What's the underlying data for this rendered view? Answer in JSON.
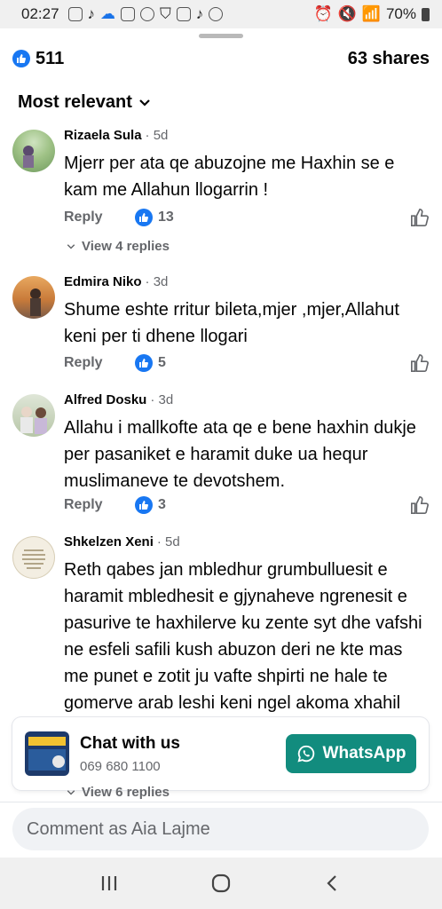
{
  "status_bar": {
    "time": "02:27",
    "battery": "70%"
  },
  "stats": {
    "likes": "511",
    "shares": "63 shares"
  },
  "sort": {
    "label": "Most relevant"
  },
  "comments": [
    {
      "author": "Rizaela Sula",
      "time": "· 5d",
      "text": "Mjerr per ata qe abuzojne me Haxhin se e kam me Allahun llogarrin !",
      "reply_label": "Reply",
      "reactions": "13",
      "view_replies": "View 4 replies"
    },
    {
      "author": "Edmira Niko",
      "time": "· 3d",
      "text": "Shume eshte rritur bileta,mjer ,mjer,Allahut keni per ti dhene llogari",
      "reply_label": "Reply",
      "reactions": "5"
    },
    {
      "author": "Alfred Dosku",
      "time": "· 3d",
      "text": "Allahu i mallkofte ata qe e bene haxhin dukje per pasaniket e haramit duke ua hequr muslimaneve te devotshem.",
      "reply_label": "Reply",
      "reactions": "3"
    },
    {
      "author": "Shkelzen Xeni",
      "time": "· 5d",
      "text": "Reth qabes jan mbledhur grumbulluesit e haramit  mbledhesit e gjynaheve ngrenesit e pasurive te haxhilerve ku zente syt dhe vafshi ne esfeli safili kush abuzon deri ne kte mas me punet e zotit ju vafte shpirti ne hale te gomerve  arab leshi keni ngel akoma xhahil me aq sakrifix sa beri i",
      "view_replies": "View 6 replies"
    }
  ],
  "ad": {
    "title": "Chat with us",
    "phone": "069 680 1100",
    "button_label": "WhatsApp",
    "button_color": "#128c7e"
  },
  "composer": {
    "placeholder": "Comment as Aia Lajme"
  },
  "colors": {
    "accent": "#1877f2",
    "secondary_text": "#65676b"
  }
}
